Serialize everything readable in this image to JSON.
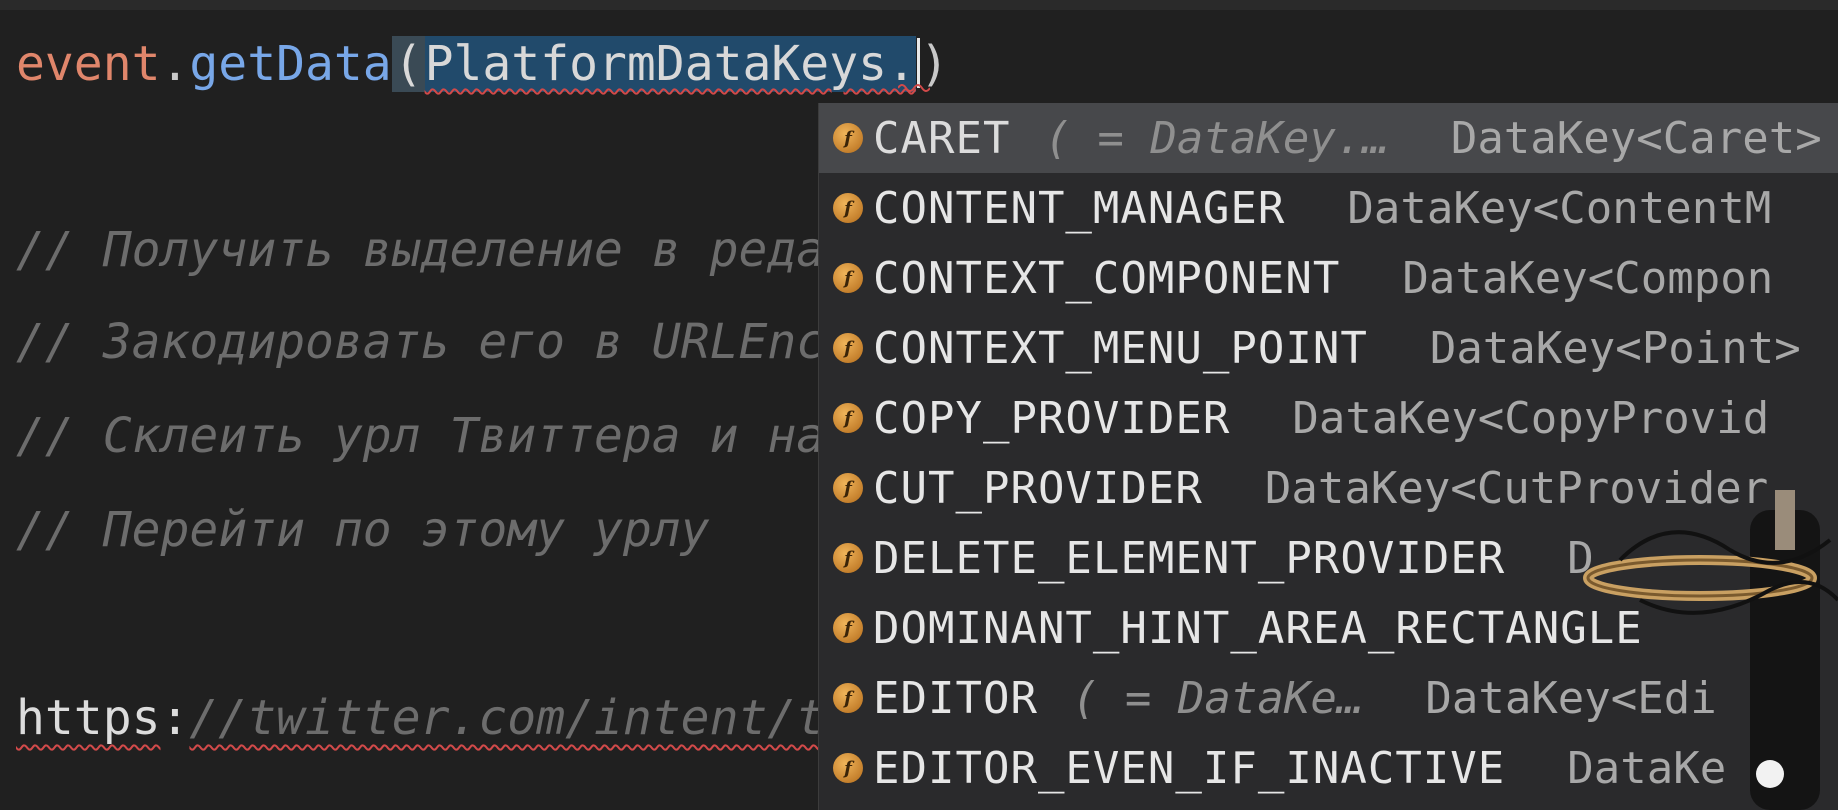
{
  "editor": {
    "code_line": {
      "receiver": "event",
      "dot": ".",
      "method": "getData",
      "open_paren": "(",
      "selected": "PlatformDataKeys.",
      "close_paren": ")"
    },
    "comments": [
      "// Получить выделение в редак",
      "// Закодировать его в URLEnco",
      "// Склеить урл Твиттера и наш",
      "// Перейти по этому урлу"
    ],
    "url_line": {
      "protocol": "https",
      "colon": ":",
      "rest": "//twitter.com/intent/tw"
    }
  },
  "completion": {
    "items": [
      {
        "name": "CARET",
        "hint": "( = DataKey.…",
        "type": "DataKey<Caret>",
        "selected": true
      },
      {
        "name": "CONTENT_MANAGER",
        "hint": "",
        "type": "DataKey<ContentM"
      },
      {
        "name": "CONTEXT_COMPONENT",
        "hint": "",
        "type": "DataKey<Compon"
      },
      {
        "name": "CONTEXT_MENU_POINT",
        "hint": "",
        "type": "DataKey<Point>"
      },
      {
        "name": "COPY_PROVIDER",
        "hint": "",
        "type": "DataKey<CopyProvid"
      },
      {
        "name": "CUT_PROVIDER",
        "hint": "",
        "type": "DataKey<CutProvider"
      },
      {
        "name": "DELETE_ELEMENT_PROVIDER",
        "hint": "",
        "type": "D"
      },
      {
        "name": "DOMINANT_HINT_AREA_RECTANGLE",
        "hint": "",
        "type": ""
      },
      {
        "name": "EDITOR",
        "hint": "( = DataKe…",
        "type": "DataKey<Edi"
      },
      {
        "name": "EDITOR_EVEN_IF_INACTIVE",
        "hint": "",
        "type": "DataKe"
      }
    ],
    "icon_glyph": "f",
    "icon_name": "field-icon"
  },
  "colors": {
    "background": "#202020",
    "selection": "#214a6b",
    "popup_background": "#2a2a2c",
    "popup_selected": "#47484b",
    "error_squiggle": "#d24a4a"
  }
}
